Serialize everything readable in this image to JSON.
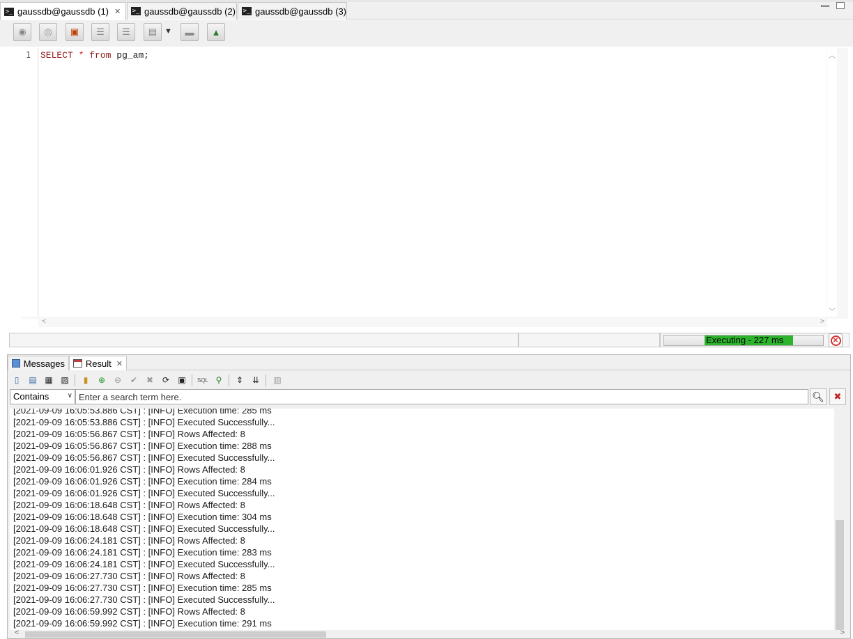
{
  "editor_tabs": [
    {
      "label": "gaussdb@gaussdb (1)",
      "active": true,
      "closable": true
    },
    {
      "label": "gaussdb@gaussdb (2)",
      "active": false
    },
    {
      "label": "gaussdb@gaussdb (3)",
      "active": false
    }
  ],
  "editor": {
    "line_number": "1",
    "code": {
      "kw1": "SELECT",
      "op": "*",
      "kw2": "from",
      "rest": "pg_am;"
    }
  },
  "status": {
    "progress_label": "Executing - 227 ms",
    "progress_fraction": 0.7
  },
  "panel_tabs": [
    {
      "label": "Messages",
      "active": false
    },
    {
      "label": "Result",
      "active": true,
      "closable": true
    }
  ],
  "search": {
    "match_mode": "Contains",
    "placeholder": "Enter a search term here."
  },
  "log_partial_top": "[2021-09-09 16:05:53.886 CST] : [INFO] Execution time: 285 ms",
  "log_lines": [
    "[2021-09-09 16:05:53.886 CST] : [INFO] Executed Successfully...",
    "[2021-09-09 16:05:56.867 CST] : [INFO] Rows Affected: 8",
    "[2021-09-09 16:05:56.867 CST] : [INFO] Execution time: 288 ms",
    "[2021-09-09 16:05:56.867 CST] : [INFO] Executed Successfully...",
    "[2021-09-09 16:06:01.926 CST] : [INFO] Rows Affected: 8",
    "[2021-09-09 16:06:01.926 CST] : [INFO] Execution time: 284 ms",
    "[2021-09-09 16:06:01.926 CST] : [INFO] Executed Successfully...",
    "[2021-09-09 16:06:18.648 CST] : [INFO] Rows Affected: 8",
    "[2021-09-09 16:06:18.648 CST] : [INFO] Execution time: 304 ms",
    "[2021-09-09 16:06:18.648 CST] : [INFO] Executed Successfully...",
    "[2021-09-09 16:06:24.181 CST] : [INFO] Rows Affected: 8",
    "[2021-09-09 16:06:24.181 CST] : [INFO] Execution time: 283 ms",
    "[2021-09-09 16:06:24.181 CST] : [INFO] Executed Successfully...",
    "[2021-09-09 16:06:27.730 CST] : [INFO] Rows Affected: 8",
    "[2021-09-09 16:06:27.730 CST] : [INFO] Execution time: 285 ms",
    "[2021-09-09 16:06:27.730 CST] : [INFO] Executed Successfully...",
    "[2021-09-09 16:06:59.992 CST] : [INFO] Rows Affected: 8",
    "[2021-09-09 16:06:59.992 CST] : [INFO] Execution time: 291 ms"
  ],
  "colors": {
    "progress_green": "#2cb52c",
    "keyword": "#8b1a1a",
    "operator": "#d21818",
    "stop": "#d23030"
  }
}
